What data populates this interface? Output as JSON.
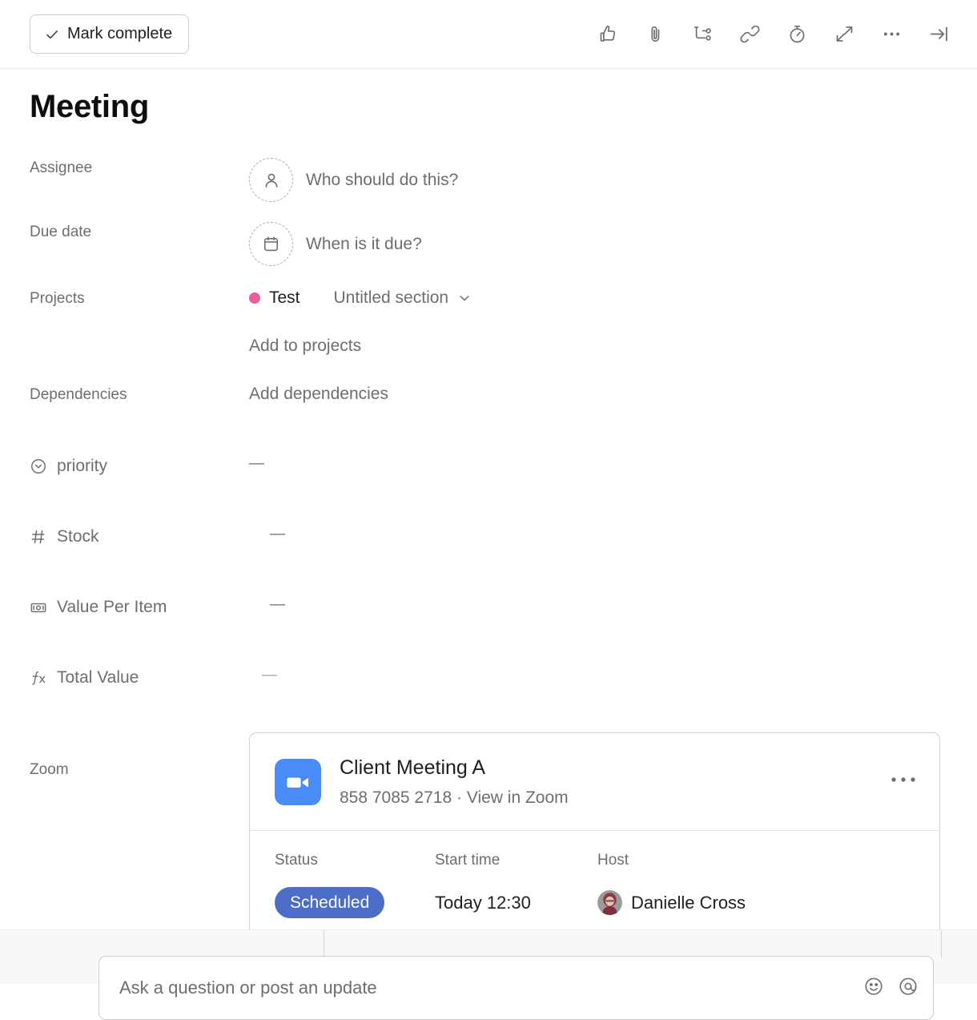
{
  "toolbar": {
    "mark_complete_label": "Mark complete",
    "check_icon": "check-icon",
    "actions": [
      {
        "name": "like-icon",
        "title": "Like"
      },
      {
        "name": "attachment-icon",
        "title": "Attach"
      },
      {
        "name": "subtask-icon",
        "title": "Add subtask"
      },
      {
        "name": "link-icon",
        "title": "Copy task link"
      },
      {
        "name": "timer-icon",
        "title": "Timer"
      },
      {
        "name": "fullscreen-icon",
        "title": "Full screen"
      },
      {
        "name": "more-icon",
        "title": "More actions"
      },
      {
        "name": "close-pane-icon",
        "title": "Close details pane"
      }
    ]
  },
  "task": {
    "title": "Meeting"
  },
  "fields": {
    "assignee": {
      "label": "Assignee",
      "placeholder": "Who should do this?",
      "icon": "person-icon"
    },
    "due_date": {
      "label": "Due date",
      "placeholder": "When is it due?",
      "icon": "calendar-icon"
    },
    "projects": {
      "label": "Projects",
      "project_name": "Test",
      "project_color": "#EC5D9E",
      "section_name": "Untitled section",
      "add_label": "Add to projects"
    },
    "dependencies": {
      "label": "Dependencies",
      "add_label": "Add dependencies"
    },
    "custom": [
      {
        "label": "priority",
        "value": "—",
        "icon": "dropdown-circle-icon"
      },
      {
        "label": "Stock",
        "value": "—",
        "icon": "number-icon"
      },
      {
        "label": "Value Per Item",
        "value": "—",
        "icon": "money-icon"
      },
      {
        "label": "Total Value",
        "value": "—",
        "icon": "formula-icon"
      }
    ],
    "zoom": {
      "label": "Zoom"
    }
  },
  "zoom_card": {
    "logo_color": "#4A8CF7",
    "meeting_title": "Client Meeting A",
    "meeting_id": "858 7085 2718",
    "separator": "·",
    "view_link": "View in Zoom",
    "menu_icon": "more-icon",
    "columns": [
      "Status",
      "Start time",
      "Host"
    ],
    "status_value": "Scheduled",
    "status_color": "#4C6EC9",
    "start_time": "Today 12:30",
    "host_name": "Danielle Cross"
  },
  "comment": {
    "placeholder": "Ask a question or post an update",
    "icons": [
      "emoji-icon",
      "mention-icon"
    ]
  }
}
